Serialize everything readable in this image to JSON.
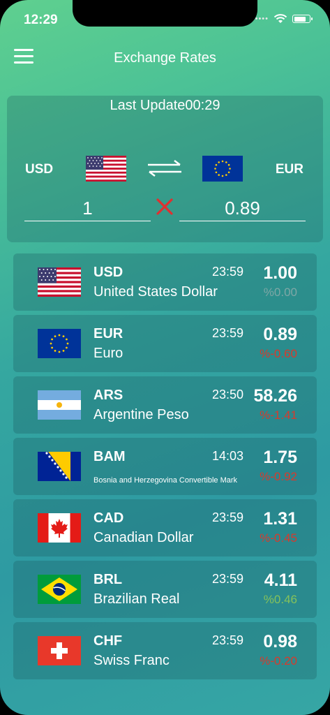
{
  "status_bar": {
    "time": "12:29"
  },
  "header": {
    "title": "Exchange Rates"
  },
  "converter": {
    "last_update_label": "Last Update",
    "last_update_time": "00:29",
    "from_code": "USD",
    "to_code": "EUR",
    "from_amount": "1",
    "to_amount": "0.89"
  },
  "rates": [
    {
      "code": "USD",
      "name": "United States Dollar",
      "time": "23:59",
      "rate": "1.00",
      "change": "%0.00",
      "trend": "neutral"
    },
    {
      "code": "EUR",
      "name": "Euro",
      "time": "23:59",
      "rate": "0.89",
      "change": "%-0.60",
      "trend": "down"
    },
    {
      "code": "ARS",
      "name": "Argentine Peso",
      "time": "23:50",
      "rate": "58.26",
      "change": "%-1.41",
      "trend": "down"
    },
    {
      "code": "BAM",
      "name": "Bosnia and Herzegovina Convertible Mark",
      "time": "14:03",
      "rate": "1.75",
      "change": "%-0.92",
      "trend": "down"
    },
    {
      "code": "CAD",
      "name": "Canadian Dollar",
      "time": "23:59",
      "rate": "1.31",
      "change": "%-0.45",
      "trend": "down"
    },
    {
      "code": "BRL",
      "name": "Brazilian Real",
      "time": "23:59",
      "rate": "4.11",
      "change": "%0.46",
      "trend": "up"
    },
    {
      "code": "CHF",
      "name": "Swiss Franc",
      "time": "23:59",
      "rate": "0.98",
      "change": "%-0.20",
      "trend": "down"
    }
  ],
  "colors": {
    "down": "#d83a2c",
    "up": "#86c25a",
    "neutral": "#7fa7a6",
    "clear": "#e03030"
  }
}
